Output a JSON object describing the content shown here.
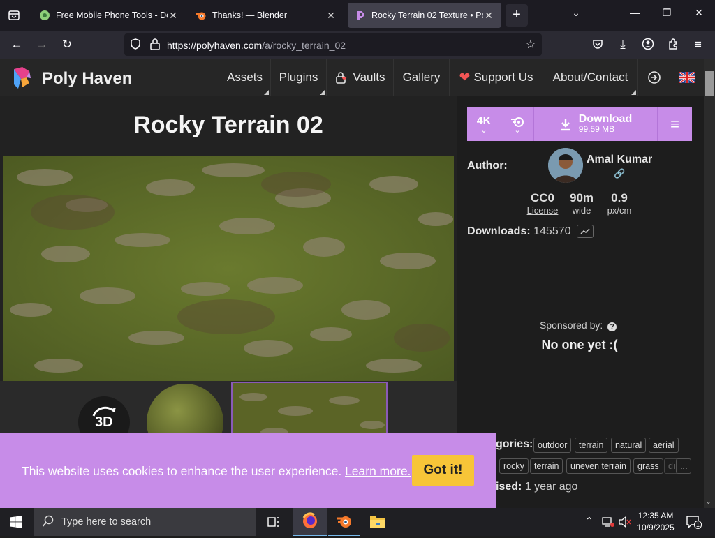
{
  "browser": {
    "tabs": [
      {
        "title": "Free Mobile Phone Tools - Dow",
        "icon": "android-phone-icon"
      },
      {
        "title": "Thanks! — Blender",
        "icon": "blender-icon"
      },
      {
        "title": "Rocky Terrain 02 Texture • Poly",
        "icon": "polyhaven-icon"
      }
    ],
    "url_host": "https://polyhaven.com",
    "url_path": "/a/rocky_terrain_02"
  },
  "site": {
    "brand": "Poly Haven",
    "nav": [
      "Assets",
      "Plugins",
      "Vaults",
      "Gallery",
      "Support Us",
      "About/Contact"
    ]
  },
  "asset": {
    "title": "Rocky Terrain 02",
    "resolution": "4K",
    "download_label": "Download",
    "download_size": "99.59 MB",
    "author_label": "Author:",
    "author_name": "Amal Kumar",
    "license_value": "CC0",
    "license_label": "License",
    "width_value": "90m",
    "width_label": "wide",
    "density_value": "0.9",
    "density_label": "px/cm",
    "downloads_label": "Downloads:",
    "downloads_count": "145570",
    "sponsored_label": "Sponsored by:",
    "sponsored_value": "No one yet :(",
    "categories_label": "gories:",
    "categories": [
      "outdoor",
      "terrain",
      "natural",
      "aerial"
    ],
    "tags": [
      "rocky",
      "terrain",
      "uneven terrain",
      "grass",
      "dı",
      "..."
    ],
    "published_label": "ised:",
    "published_value": "1 year ago",
    "view3d_label": "3D"
  },
  "cookie": {
    "text": "This website uses cookies to enhance the user experience.",
    "link": "Learn more.",
    "button": "Got it!"
  },
  "taskbar": {
    "search_placeholder": "Type here to search",
    "time": "12:35 AM",
    "date": "10/9/2025",
    "notification_count": "1"
  },
  "colors": {
    "accent": "#c78ce8",
    "cookie_button": "#f7c538",
    "header_bg": "#262626"
  }
}
